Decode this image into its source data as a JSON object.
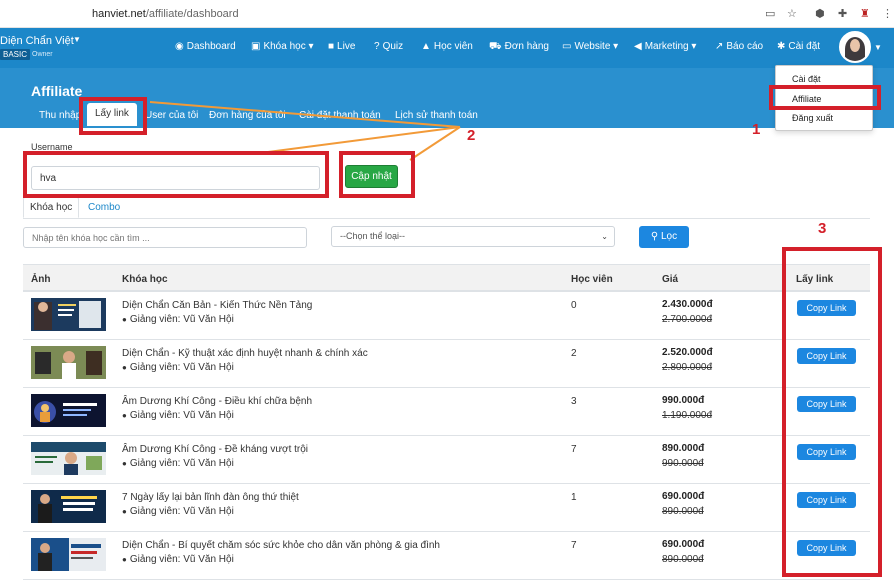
{
  "browser": {
    "url_host": "hanviet.net",
    "url_path": "/affiliate/dashboard"
  },
  "brand": {
    "name": "Diện Chẩn Việt",
    "plan": "BASIC",
    "role": "Owner"
  },
  "nav": {
    "dashboard": "Dashboard",
    "courses": "Khóa học",
    "live": "Live",
    "quiz": "Quiz",
    "students": "Học viên",
    "orders": "Đơn hàng",
    "website": "Website",
    "marketing": "Marketing",
    "reports": "Báo cáo",
    "settings": "Cài đặt"
  },
  "dropdown": {
    "items": [
      "Cài đặt",
      "Affiliate",
      "Đăng xuất"
    ]
  },
  "page": {
    "title": "Affiliate",
    "tabs": [
      "Thu nhập",
      "Lấy link",
      "User của tôi",
      "Đơn hàng của tôi",
      "Cài đặt thanh toán",
      "Lịch sử thanh toán"
    ]
  },
  "form": {
    "username_label": "Username",
    "username_value": "hva",
    "update_button": "Cập nhật"
  },
  "content_tabs": [
    "Khóa học",
    "Combo"
  ],
  "filters": {
    "search_placeholder": "Nhập tên khóa học cần tìm ...",
    "category_select": "--Chọn thể loại--",
    "filter_button": "Lọc"
  },
  "table": {
    "headers": [
      "Ảnh",
      "Khóa học",
      "Học viên",
      "Giá",
      "Lấy link"
    ],
    "rows": [
      {
        "course": "Diện Chẩn Căn Bản - Kiến Thức Nền Tảng",
        "teacher": "Giảng viên: Vũ Văn Hội",
        "students": "0",
        "price": "2.430.000đ",
        "old_price": "2.700.000đ",
        "action": "Copy Link"
      },
      {
        "course": "Diện Chẩn - Kỹ thuật xác định huyệt nhanh & chính xác",
        "teacher": "Giảng viên: Vũ Văn Hội",
        "students": "2",
        "price": "2.520.000đ",
        "old_price": "2.800.000đ",
        "action": "Copy Link"
      },
      {
        "course": "Âm Dương Khí Công - Điều khí chữa bệnh",
        "teacher": "Giảng viên: Vũ Văn Hội",
        "students": "3",
        "price": "990.000đ",
        "old_price": "1.190.000đ",
        "action": "Copy Link"
      },
      {
        "course": "Âm Dương Khí Công - Đề kháng vượt trội",
        "teacher": "Giảng viên: Vũ Văn Hội",
        "students": "7",
        "price": "890.000đ",
        "old_price": "990.000đ",
        "action": "Copy Link"
      },
      {
        "course": "7 Ngày lấy lại bản lĩnh đàn ông thứ thiệt",
        "teacher": "Giảng viên: Vũ Văn Hội",
        "students": "1",
        "price": "690.000đ",
        "old_price": "890.000đ",
        "action": "Copy Link"
      },
      {
        "course": "Diện Chẩn - Bí quyết chăm sóc sức khỏe cho dân văn phòng & gia đình",
        "teacher": "Giảng viên: Vũ Văn Hội",
        "students": "7",
        "price": "690.000đ",
        "old_price": "890.000đ",
        "action": "Copy Link"
      }
    ]
  },
  "annotations": {
    "step1": "1",
    "step2": "2",
    "step3": "3",
    "color": "#d4202a",
    "arrow_color": "#f29a38"
  },
  "colors": {
    "nav_bg": "#1c87c9",
    "header_bg": "#2a90cf",
    "primary_button": "#1c87e0",
    "success_button": "#28a745"
  }
}
